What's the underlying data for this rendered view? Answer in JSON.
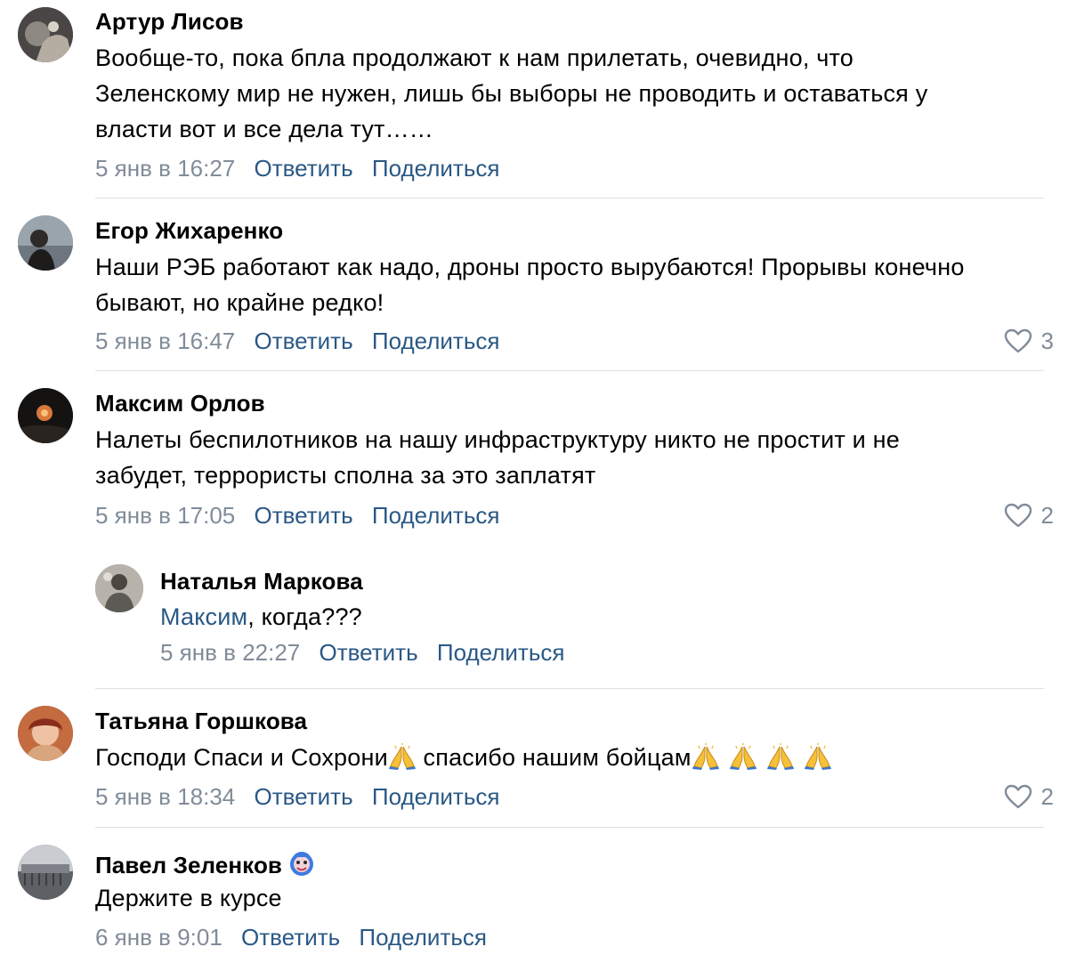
{
  "comments": [
    {
      "author": "Артур Лисов",
      "text": "Вообще-то, пока бпла продолжают к нам прилетать, очевидно, что\nЗеленскому мир не нужен, лишь бы выборы не проводить и оставаться у\nвласти вот и все дела тут……",
      "date": "5 янв в 16:27",
      "reply_label": "Ответить",
      "share_label": "Поделиться",
      "likes": ""
    },
    {
      "author": "Егор Жихаренко",
      "text": "Наши РЭБ работают как надо, дроны просто вырубаются! Прорывы конечно\nбывают, но крайне редко!",
      "date": "5 янв в 16:47",
      "reply_label": "Ответить",
      "share_label": "Поделиться",
      "likes": "3"
    },
    {
      "author": "Максим Орлов",
      "text": "Налеты беспилотников на нашу инфраструктуру никто не простит и не\nзабудет, террористы сполна за это заплатят",
      "date": "5 янв в 17:05",
      "reply_label": "Ответить",
      "share_label": "Поделиться",
      "likes": "2"
    },
    {
      "author": "Наталья Маркова",
      "mention": "Максим",
      "text": ", когда???",
      "date": "5 янв в 22:27",
      "reply_label": "Ответить",
      "share_label": "Поделиться",
      "likes": ""
    },
    {
      "author": "Татьяна Горшкова",
      "text_part1": "Господи Спаси и Сохрони",
      "text_part2": "  спасибо нашим бойцам",
      "date": "5 янв в 18:34",
      "reply_label": "Ответить",
      "share_label": "Поделиться",
      "likes": "2"
    },
    {
      "author": "Павел Зеленков",
      "text": "Держите в курсе",
      "date": "6 янв в 9:01",
      "reply_label": "Ответить",
      "share_label": "Поделиться",
      "likes": ""
    }
  ],
  "colors": {
    "link": "#2a5885",
    "meta": "#818c99",
    "divider": "#dce1e6"
  },
  "icons": {
    "like": "heart-outline-icon",
    "emoji": "folded-hands-emoji",
    "badge": "smiley-badge-icon"
  }
}
